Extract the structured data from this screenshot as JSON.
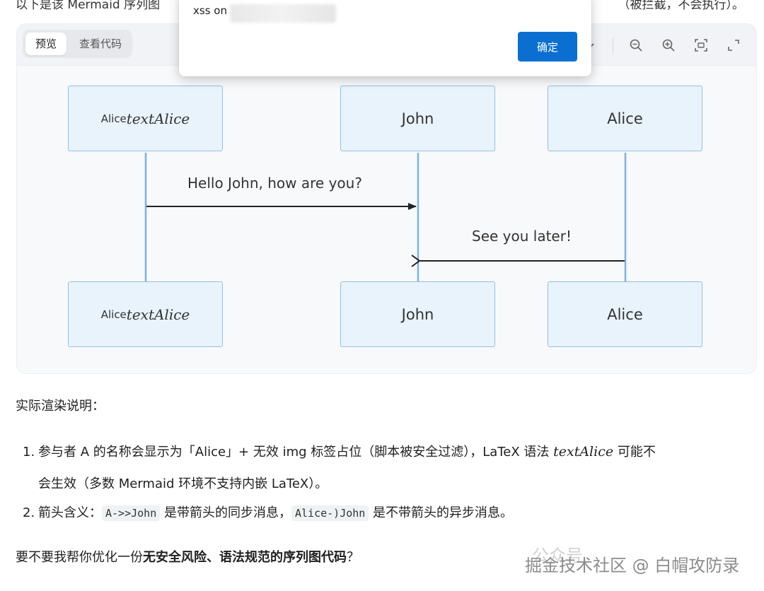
{
  "top_text": {
    "left": "以下是该 Mermaid 序列图",
    "right": "（被拦截，不会执行）。"
  },
  "toolbar": {
    "tabs": [
      {
        "label": "预览",
        "active": true
      },
      {
        "label": "查看代码",
        "active": false
      }
    ],
    "icons": [
      "chevron-down-icon",
      "zoom-out-icon",
      "zoom-in-icon",
      "fit-screen-icon",
      "fullscreen-icon"
    ]
  },
  "alert": {
    "message": "xss on",
    "ok_label": "确定",
    "accent": "#0b6fd1"
  },
  "diagram": {
    "participants": [
      {
        "small": "Alice",
        "latex": "textAlice"
      },
      {
        "label": "John"
      },
      {
        "label": "Alice"
      }
    ],
    "messages": [
      {
        "text": "Hello John, how are you?"
      },
      {
        "text": "See you later!"
      }
    ],
    "colors": {
      "actor_fill": "#e8f3fc",
      "actor_border": "#94bfe8",
      "lifeline": "#7fb0e6",
      "arrow": "#222222"
    }
  },
  "content": {
    "heading": "实际渲染说明：",
    "items": [
      {
        "num": "1.",
        "line1_before": "参与者 A 的名称会显示为「Alice」+ 无效 img 标签占位（脚本被安全过滤），LaTeX 语法 ",
        "line1_latex": "textAlice",
        "line1_after": " 可能不",
        "line2": "会生效（多数 Mermaid 环境不支持内嵌 LaTeX）。"
      },
      {
        "num": "2.",
        "text1": "箭头含义：",
        "code1": "A->>John",
        "text2": " 是带箭头的同步消息，",
        "code2": "Alice-)John",
        "text3": " 是不带箭头的异步消息。"
      }
    ],
    "question_before": "要不要我帮你优化一份",
    "question_bold": "无安全风险、语法规范的序列图代码",
    "question_after": "？"
  },
  "watermark": {
    "text": "掘金技术社区 @ 白帽攻防录",
    "bg_text": "公众号"
  }
}
